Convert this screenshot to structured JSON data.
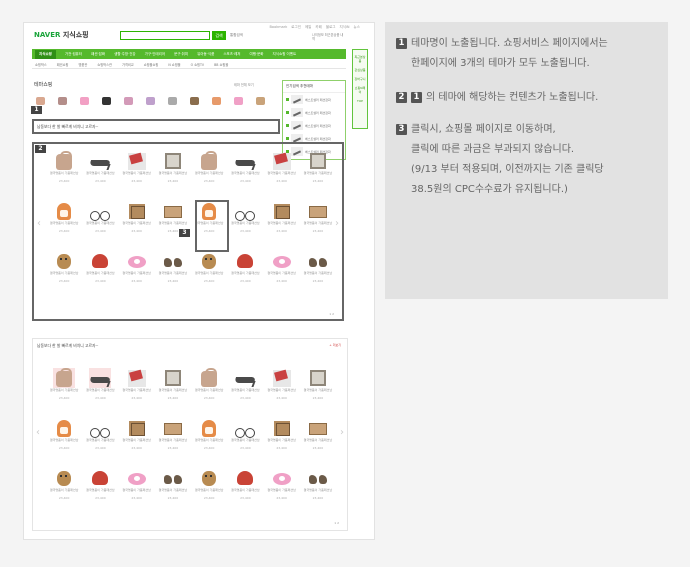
{
  "left_panel": {
    "logo": "NAVER",
    "logo_sub": "지식쇼핑",
    "util_links": [
      "Bookmark",
      "로그인",
      "메일",
      "카페",
      "블로그",
      "지식iN",
      "뉴스"
    ],
    "search": {
      "button": "검색",
      "extra": "통합검색"
    },
    "user_box": "나의정보\n최근본상품 내역",
    "gnb": [
      "지식쇼핑",
      "가전·컴퓨터",
      "패션·잡화",
      "생활·주방·건강",
      "가구·인테리어",
      "문구·취미",
      "유아동·식품",
      "스포츠·레저",
      "여행·문화",
      "지식쇼핑 이벤트"
    ],
    "sub_nav": [
      "쇼핑박스",
      "패션쇼핑",
      "명품관",
      "쇼핑박스관",
      "가격비교",
      "쇼핑몰쇼핑",
      "N 쇼핑몰",
      "O 쇼핑TV",
      "BB 쇼핑몰"
    ],
    "right_nav": [
      "최근본상품",
      "관심상품",
      "장바구니",
      "쇼핑N페이",
      "TOP"
    ],
    "theme_title": "테마쇼핑",
    "theme_sub": "테마 전체 보기",
    "popup": {
      "title": "인기검색 추천테마",
      "items": [
        "베스트셀러 패션잡화",
        "베스트셀러 패션잡화",
        "베스트셀러 패션잡화",
        "베스트셀러 패션잡화",
        "베스트셀러 패션잡화"
      ]
    },
    "theme_bar_text": "남동보다 한 발 빠르게 비치니 고르자~",
    "theme_bar_count": "12개 상품",
    "marks": [
      "1",
      "2",
      "3"
    ],
    "product_title": "결국명품이 가품패션남",
    "product_price": "23,400",
    "section2": {
      "title": "남동보다 한 발 빠르게 비치니 고르자~",
      "more": "+ 더보기"
    },
    "paging": "1 2"
  },
  "notes": [
    {
      "num": "1",
      "lines": [
        "테마명이 노출됩니다. 쇼핑서비스 페이지에서는",
        "한페이지에 3개의 테마가 모두 노출됩니다."
      ]
    },
    {
      "num": "2",
      "num2": "1",
      "lines": [
        "의 테마에 해당하는 컨텐츠가 노출됩니다."
      ]
    },
    {
      "num": "3",
      "lines": [
        "클릭시, 쇼핑몰 페이지로 이동하며,",
        "클릭에 따른 과금은 부과되지 않습니다.",
        "(9/13 부터 적용되며, 이전까지는 기존 클릭당",
        "38.5원의 CPC수수료가 유지됩니다.)"
      ]
    }
  ],
  "colors": {
    "accent": "#2db400",
    "box": "#666666",
    "panel": "#e2e2e2"
  }
}
